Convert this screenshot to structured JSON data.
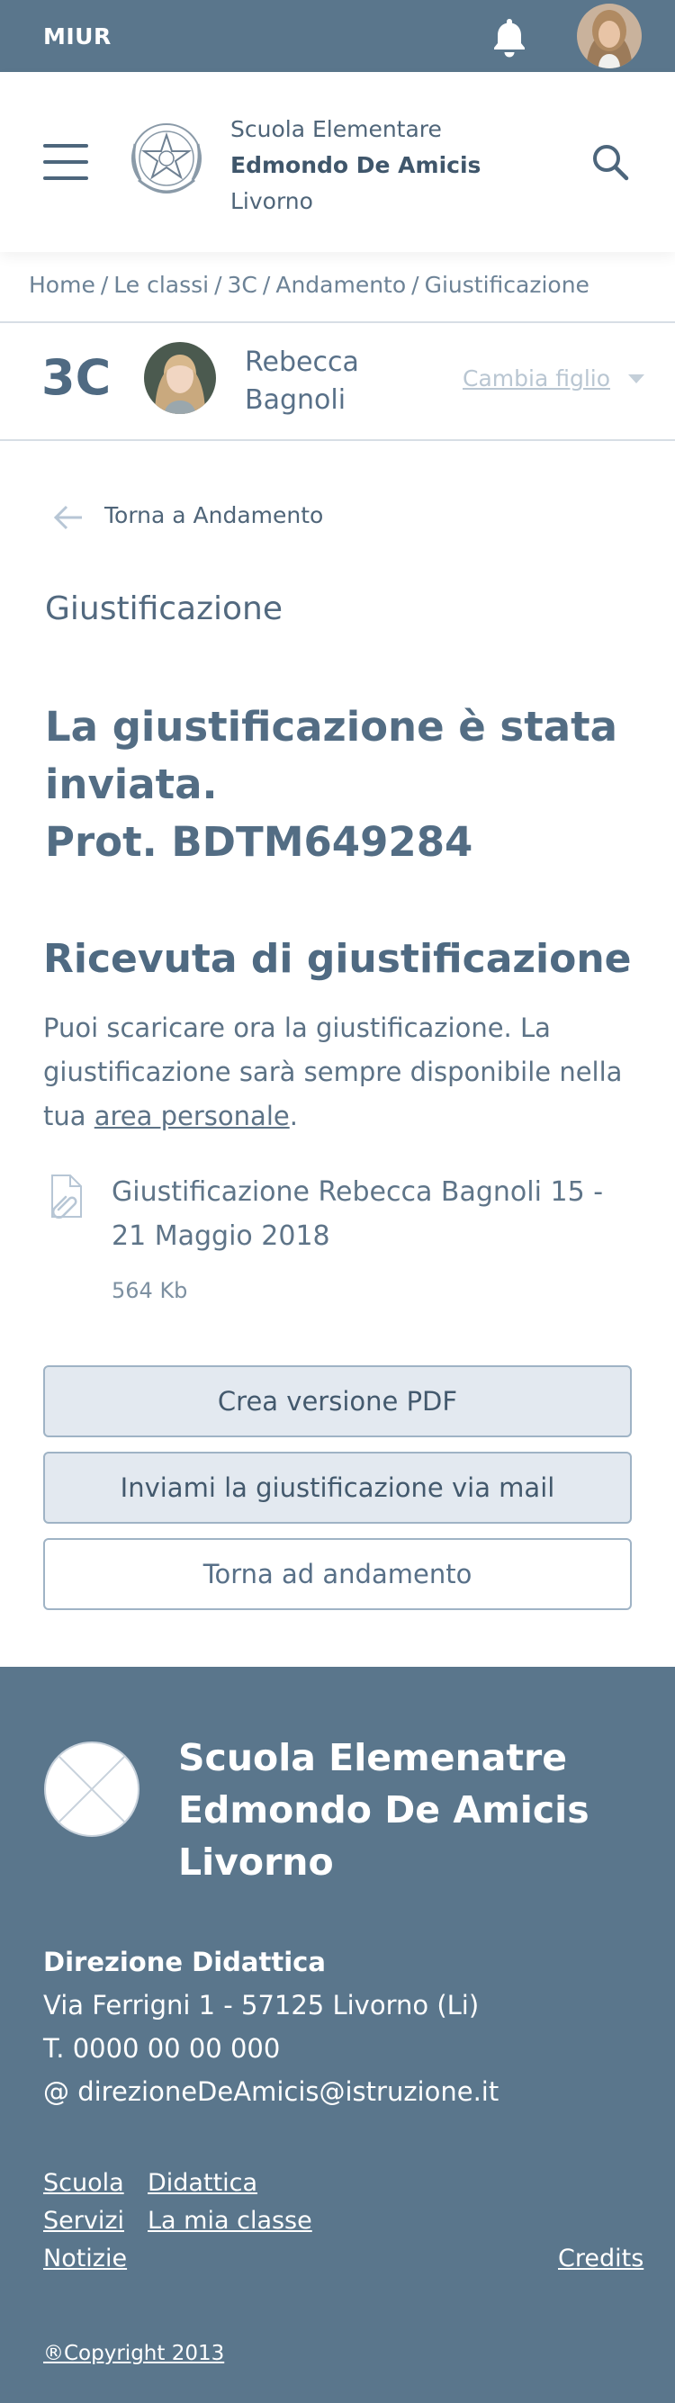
{
  "topbar": {
    "brand": "MIUR",
    "bell_icon": "bell-icon",
    "avatar": "user-avatar",
    "color": "#5a768c"
  },
  "header": {
    "menu_icon": "hamburger-icon",
    "emblem": "emblem-icon",
    "school_line1": "Scuola Elementare",
    "school_line2": "Edmondo De Amicis",
    "school_line3": "Livorno",
    "search_icon": "search-icon"
  },
  "breadcrumb": {
    "items": [
      "Home",
      "Le classi",
      "3C",
      "Andamento",
      "Giustificazione"
    ],
    "separator": "/"
  },
  "child": {
    "class_code": "3C",
    "first_name": "Rebecca",
    "last_name": "Bagnoli",
    "change_label": "Cambia figlio"
  },
  "main": {
    "back_label": "Torna a Andamento",
    "section_title": "Giustificazione",
    "confirm_line1": "La giustificazione è stata",
    "confirm_line2": "inviata.",
    "confirm_line3": "Prot. BDTM649284",
    "receipt_title": "Ricevuta di giustificazione",
    "receipt_text": "Puoi scaricare ora la giustificazione. La giustificazione sarà sempre disponibile nella tua",
    "receipt_link": "area personale",
    "receipt_end": ".",
    "file_name": "Giustificazione Rebecca Bagnoli 15 - 21 Maggio 2018",
    "file_size": "564 Kb",
    "btn_pdf": "Crea versione PDF",
    "btn_mail": "Inviami la giustificazione via mail",
    "btn_back": "Torna ad andamento"
  },
  "footer": {
    "title_line1": "Scuola Elemenatre",
    "title_line2": "Edmondo De Amicis",
    "title_line3": "Livorno",
    "dir_title": "Direzione Didattica",
    "address": "Via Ferrigni 1 - 57125 Livorno (Li)",
    "phone": "T. 0000 00 00 000",
    "email": "@ direzioneDeAmicis@istruzione.it",
    "links": {
      "scuola": "Scuola",
      "didattica": "Didattica",
      "servizi": "Servizi",
      "mia_classe": "La mia classe",
      "notizie": "Notizie",
      "credits": "Credits"
    },
    "copyright": "®Copyright 2013"
  }
}
